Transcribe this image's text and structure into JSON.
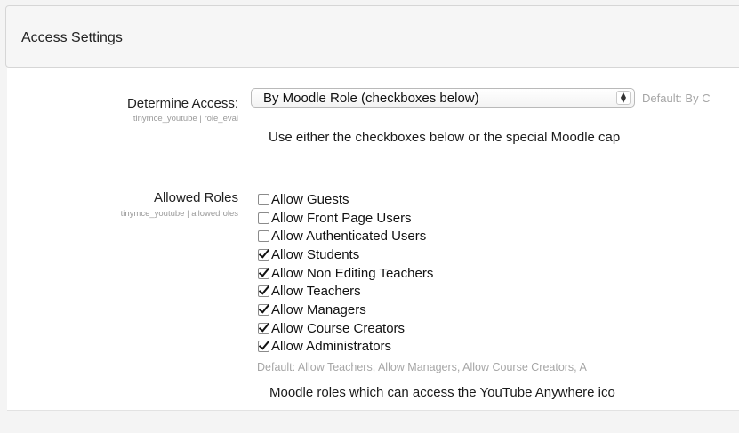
{
  "section": {
    "title": "Access Settings"
  },
  "determine_access": {
    "label": "Determine Access:",
    "sublabel": "tinymce_youtube | role_eval",
    "select_value": "By Moodle Role (checkboxes below)",
    "select_arrow": "▲\n▼",
    "default": "Default: By C",
    "description": "Use either the checkboxes below or the special Moodle cap"
  },
  "allowed_roles": {
    "label": "Allowed Roles",
    "sublabel": "tinymce_youtube | allowedroles",
    "items": [
      {
        "label": "Allow Guests",
        "checked": false
      },
      {
        "label": "Allow Front Page Users",
        "checked": false
      },
      {
        "label": "Allow Authenticated Users",
        "checked": false
      },
      {
        "label": "Allow Students",
        "checked": true
      },
      {
        "label": "Allow Non Editing Teachers",
        "checked": true
      },
      {
        "label": "Allow Teachers",
        "checked": true
      },
      {
        "label": "Allow Managers",
        "checked": true
      },
      {
        "label": "Allow Course Creators",
        "checked": true
      },
      {
        "label": "Allow Administrators",
        "checked": true
      }
    ],
    "default": "Default: Allow Teachers, Allow Managers, Allow Course Creators, A",
    "description": "Moodle roles which can access the YouTube Anywhere ico"
  }
}
